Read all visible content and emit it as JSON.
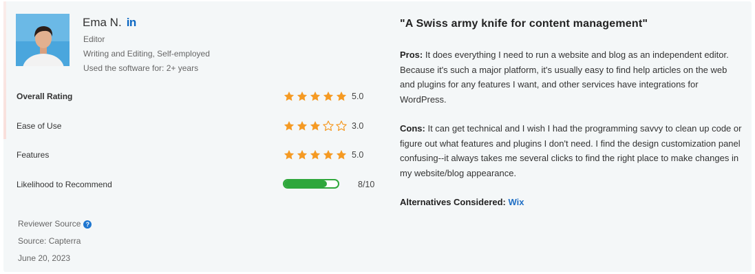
{
  "reviewer": {
    "name": "Ema N.",
    "linkedin_label": "in",
    "role": "Editor",
    "industry": "Writing and Editing, Self-employed",
    "usage": "Used the software for: 2+ years"
  },
  "ratings": [
    {
      "label": "Overall Rating",
      "stars": 5,
      "value": "5.0"
    },
    {
      "label": "Ease of Use",
      "stars": 3,
      "value": "3.0"
    },
    {
      "label": "Features",
      "stars": 5,
      "value": "5.0"
    }
  ],
  "recommend": {
    "label": "Likelihood to Recommend",
    "value": "8/10",
    "fraction": 0.8
  },
  "source": {
    "reviewer_source": "Reviewer Source",
    "help_glyph": "?",
    "source_text": "Source: Capterra",
    "date": "June 20, 2023"
  },
  "review": {
    "title": "\"A Swiss army knife for content management\"",
    "pros_label": "Pros:",
    "pros_text": "It does everything I need to run a website and blog as an independent editor. Because it's such a major platform, it's usually easy to find help articles on the web and plugins for any features I want, and other services have integrations for WordPress.",
    "cons_label": "Cons:",
    "cons_text": "It can get technical and I wish I had the programming savvy to clean up code or figure out what features and plugins I don't need. I find the design customization panel confusing--it always takes me several clicks to find the right place to make changes in my website/blog appearance.",
    "alternatives_label": "Alternatives Considered:",
    "alternatives_value": "Wix"
  },
  "colors": {
    "star": "#f59a23",
    "star_empty_stroke": "#f59a23",
    "recommend_green": "#2ea73b",
    "link_blue": "#1f6fc5",
    "linkedin_blue": "#0a66c2",
    "card_bg": "#f4f7f8"
  },
  "icons": [
    "linkedin-icon",
    "star-icon",
    "star-outline-icon",
    "help-icon"
  ]
}
